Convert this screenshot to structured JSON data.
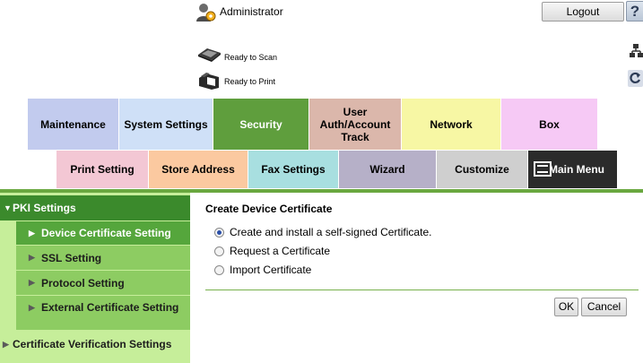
{
  "header": {
    "user_name": "Administrator",
    "logout_label": "Logout",
    "help_label": "?",
    "scan_status": "Ready to Scan",
    "print_status": "Ready to Print"
  },
  "main_tabs": [
    {
      "label": "Maintenance"
    },
    {
      "label": "System Settings"
    },
    {
      "label": "Security",
      "active": true
    },
    {
      "label": "User Auth/Account Track"
    },
    {
      "label": "Network"
    },
    {
      "label": "Box"
    }
  ],
  "sub_tabs": [
    {
      "label": "Print Setting"
    },
    {
      "label": "Store Address"
    },
    {
      "label": "Fax Settings"
    },
    {
      "label": "Wizard"
    },
    {
      "label": "Customize"
    },
    {
      "label": "To Main Menu"
    }
  ],
  "sidebar": {
    "items": [
      {
        "label": "PKI Settings",
        "marker": "▼"
      },
      {
        "label": "Device Certificate Setting",
        "marker": "▶",
        "selected": true
      },
      {
        "label": "SSL Setting",
        "marker": "▶"
      },
      {
        "label": "Protocol Setting",
        "marker": "▶"
      },
      {
        "label": "External Certificate Setting",
        "marker": "▶"
      },
      {
        "label": "Certificate Verification Settings",
        "marker": "▶"
      }
    ]
  },
  "content": {
    "title": "Create Device Certificate",
    "options": [
      {
        "label": "Create and install a self-signed Certificate.",
        "selected": true
      },
      {
        "label": "Request a Certificate",
        "selected": false
      },
      {
        "label": "Import Certificate",
        "selected": false
      }
    ],
    "ok_label": "OK",
    "cancel_label": "Cancel"
  },
  "colors": {
    "security_tab": "#5f9e3d",
    "sidebar_active": "#3b8a2c",
    "sidebar_selected": "#55a63c",
    "sidebar_item": "#8dcc62",
    "sidebar_bg": "#c6ee9a"
  }
}
